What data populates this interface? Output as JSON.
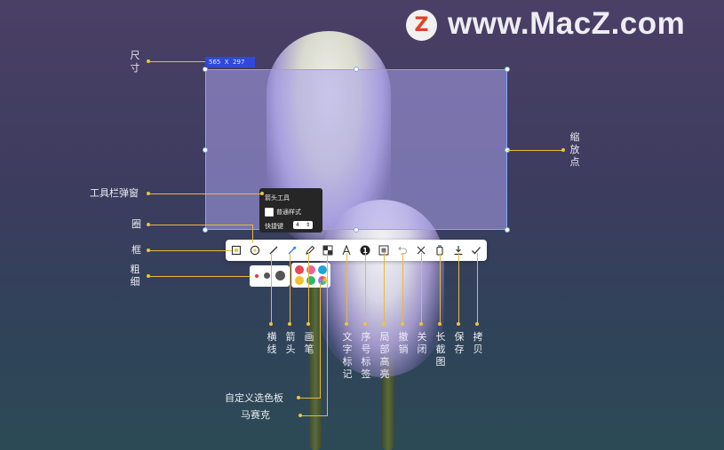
{
  "logo": {
    "badge_letter": "Z",
    "text": "www.MacZ.com"
  },
  "selection": {
    "dimensions": "565  X  297"
  },
  "popup": {
    "title": "箭头工具",
    "checkbox_label": "普通样式",
    "shortcut_label": "快捷键",
    "shortcut_value": "4"
  },
  "toolbar": {
    "tools": [
      "square-icon",
      "circle-icon",
      "line-icon",
      "arrow-icon",
      "pen-icon",
      "mosaic-icon",
      "text-icon",
      "number-badge-icon",
      "highlight-icon",
      "undo-icon",
      "close-icon",
      "long-screenshot-icon",
      "save-icon",
      "copy-icon"
    ],
    "active_tool": "arrow-icon"
  },
  "size_panel": {
    "selected_color": "#e53935"
  },
  "palette": {
    "colors": [
      "#e84855",
      "#f06292",
      "#1ea5d9",
      "#f2c12e",
      "#2fb865",
      "#b37be0"
    ]
  },
  "annotations": {
    "size": "尺寸",
    "scale_points": "缩放点",
    "toolbar_popup": "工具栏弹窗",
    "circle": "圈",
    "frame": "框",
    "thickness": "粗细",
    "hline": "横线",
    "arrow": "箭头",
    "brush": "画笔",
    "text_mark": "文字标记",
    "number_label": "序号标签",
    "local_highlight": "局部高亮",
    "undo": "撤销",
    "close": "关闭",
    "long_screenshot": "长截图",
    "save": "保存",
    "copy": "拷贝",
    "custom_palette": "自定义选色板",
    "mosaic": "马赛克"
  }
}
